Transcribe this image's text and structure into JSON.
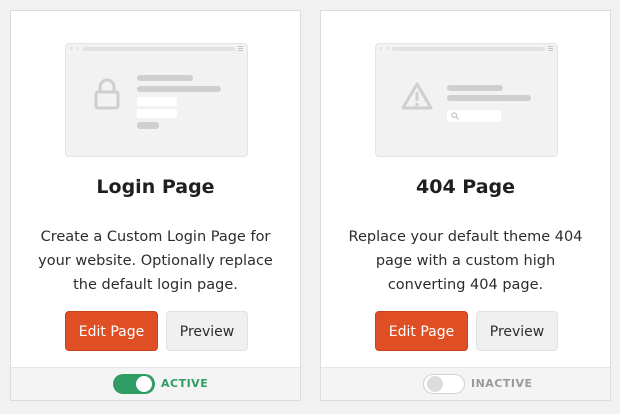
{
  "colors": {
    "primary_button": "#e04e24",
    "active_green": "#2e9d63",
    "inactive_gray": "#9a9a9a"
  },
  "cards": [
    {
      "title": "Login Page",
      "description": "Create a Custom Login Page for your website. Optionally replace the default login page.",
      "edit_label": "Edit Page",
      "preview_label": "Preview",
      "status_label": "ACTIVE",
      "toggle_on": true,
      "illustration_icon": "lock-icon"
    },
    {
      "title": "404 Page",
      "description": "Replace your default theme 404 page with a custom high converting 404 page.",
      "edit_label": "Edit Page",
      "preview_label": "Preview",
      "status_label": "INACTIVE",
      "toggle_on": false,
      "illustration_icon": "warning-icon"
    }
  ]
}
